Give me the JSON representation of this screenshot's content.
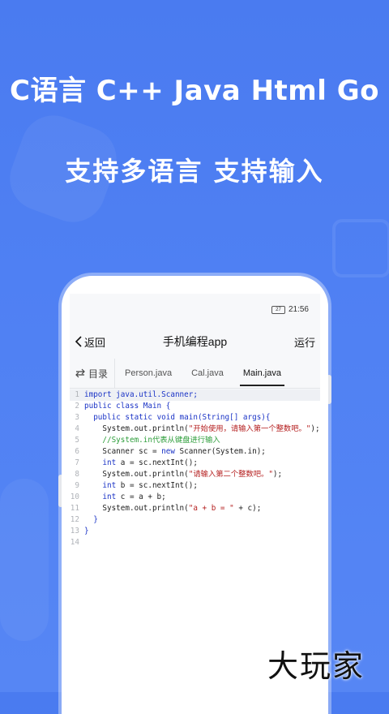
{
  "headline": {
    "line1": "C语言 C++ Java Html Go",
    "line2": "支持多语言 支持输入"
  },
  "status": {
    "battery": "27",
    "time": "21:56"
  },
  "app": {
    "back_label": "返回",
    "title": "手机编程app",
    "run_label": "运行"
  },
  "tabs": {
    "dir_label": "目录",
    "files": [
      "Person.java",
      "Cal.java",
      "Main.java"
    ],
    "active": "Main.java"
  },
  "code": {
    "line_numbers": [
      "1",
      "2",
      "3",
      "4",
      "5",
      "6",
      "7",
      "8",
      "9",
      "10",
      "11",
      "12",
      "13",
      "14"
    ],
    "l1": "import java.util.Scanner;",
    "l2": "public class Main {",
    "l3": "public static void main(String[] args){",
    "l4a": "System.out.println(",
    "l4s": "\"开始使用，请输入第一个整数吧。\"",
    "l5": "//System.in代表从键盘进行输入",
    "l6a": "Scanner sc = ",
    "l6k": "new",
    "l6b": " Scanner(System.in);",
    "l7k": "int",
    "l7b": " a = sc.nextInt();",
    "l8a": "System.out.println(",
    "l8s": "\"请输入第二个整数吧。\"",
    "l9k": "int",
    "l9b": " b = sc.nextInt();",
    "l10k": "int",
    "l10b": " c = a + b;",
    "l11a": "System.out.println(",
    "l11s": "\"a + b = \"",
    "l11b": " + c);",
    "l12": "}",
    "l13": "}"
  },
  "watermark": "大玩家",
  "colors": {
    "background": "#4f80f3",
    "keyword": "#1a33c6",
    "string": "#b52020",
    "comment": "#2c9d3a"
  }
}
